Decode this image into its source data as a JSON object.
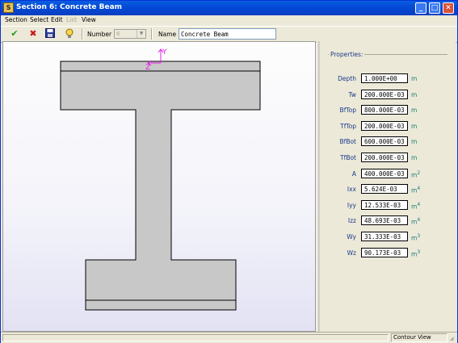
{
  "window": {
    "title": "Section 6: Concrete Beam",
    "minimize": "_",
    "maximize": "□",
    "close": "✕"
  },
  "menu": {
    "items": [
      {
        "label": "Section",
        "enabled": true
      },
      {
        "label": "Select",
        "enabled": true
      },
      {
        "label": "Edit",
        "enabled": true
      },
      {
        "label": "List",
        "enabled": false
      },
      {
        "label": "View",
        "enabled": true
      }
    ]
  },
  "toolbar": {
    "number_label": "Number",
    "number_value": "6",
    "name_label": "Name",
    "name_value": "Concrete Beam",
    "icons": [
      "check-icon",
      "delete-icon",
      "save-icon",
      "help-icon"
    ]
  },
  "canvas": {
    "axis_y": "Y",
    "axis_z": "Z",
    "axis_color": "#e020e0",
    "fill_color": "#c8c8c8"
  },
  "properties": {
    "title": "Properties:",
    "rows": [
      {
        "label": "Depth",
        "value": "1.000E+00",
        "unit": "m",
        "exp": ""
      },
      {
        "label": "Tw",
        "value": "200.000E-03",
        "unit": "m",
        "exp": ""
      },
      {
        "label": "BfTop",
        "value": "800.000E-03",
        "unit": "m",
        "exp": ""
      },
      {
        "label": "TfTop",
        "value": "200.000E-03",
        "unit": "m",
        "exp": ""
      },
      {
        "label": "BfBot",
        "value": "600.000E-03",
        "unit": "m",
        "exp": ""
      },
      {
        "label": "TfBot",
        "value": "200.000E-03",
        "unit": "m",
        "exp": ""
      },
      {
        "label": "A",
        "value": "400.000E-03",
        "unit": "m",
        "exp": "2"
      },
      {
        "label": "Ixx",
        "value": "5.624E-03",
        "unit": "m",
        "exp": "4"
      },
      {
        "label": "Iyy",
        "value": "12.533E-03",
        "unit": "m",
        "exp": "4"
      },
      {
        "label": "Izz",
        "value": "48.693E-03",
        "unit": "m",
        "exp": "4"
      },
      {
        "label": "Wy",
        "value": "31.333E-03",
        "unit": "m",
        "exp": "3"
      },
      {
        "label": "Wz",
        "value": "90.173E-03",
        "unit": "m",
        "exp": "3"
      }
    ]
  },
  "status": {
    "view": "Contour View"
  }
}
